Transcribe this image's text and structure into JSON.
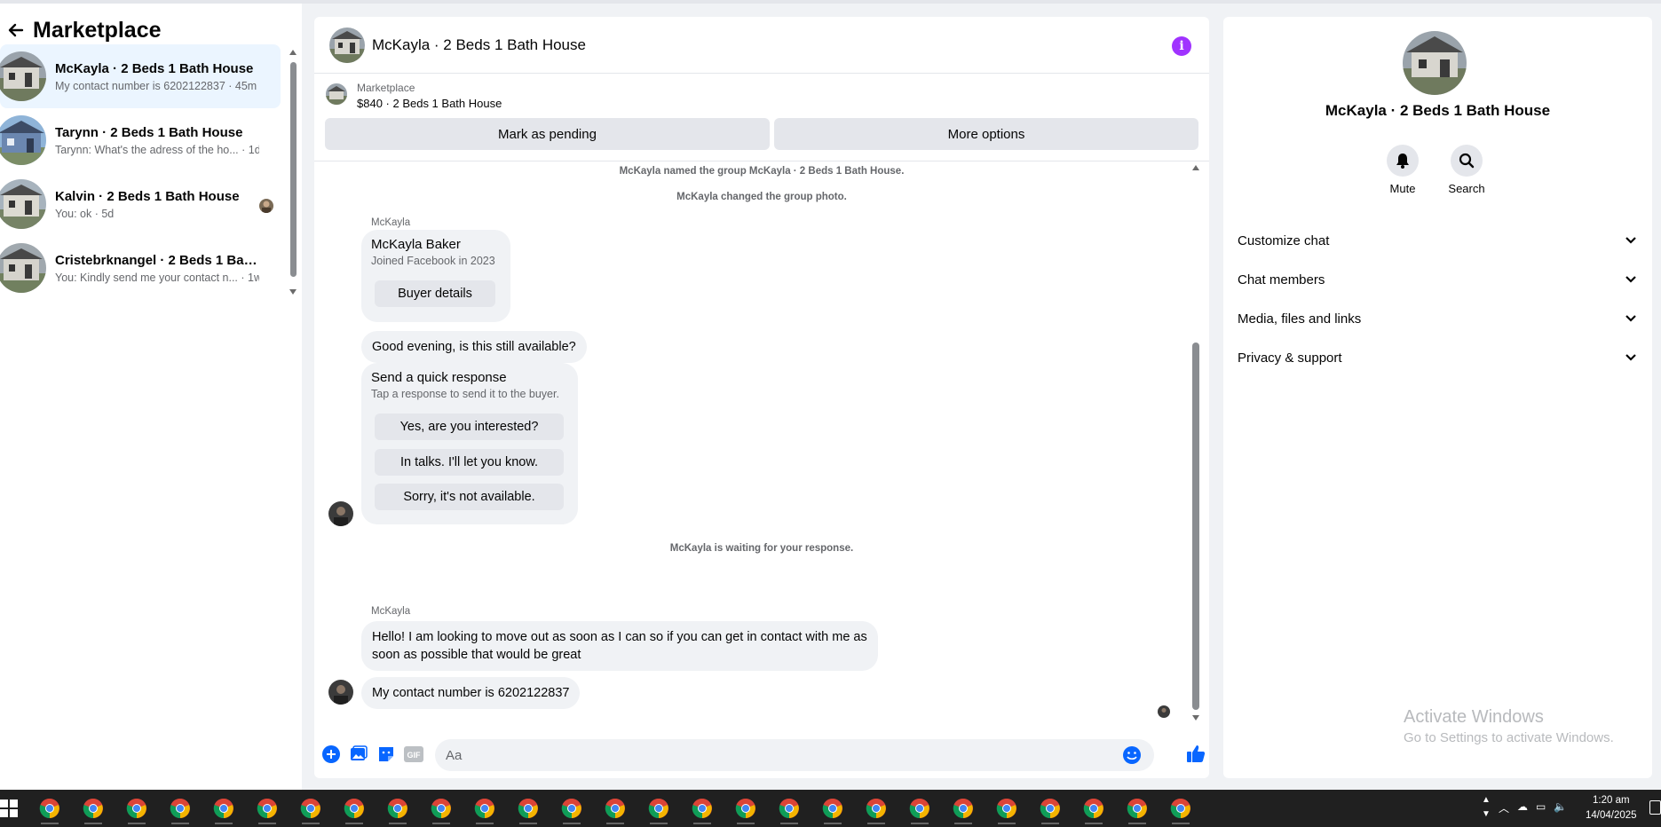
{
  "sidebar": {
    "title": "Marketplace",
    "conversations": [
      {
        "name": "McKayla · 2 Beds 1 Bath House",
        "snippet": "My contact number is 6202122837 · 45m",
        "active": true
      },
      {
        "name": "Tarynn · 2 Beds 1 Bath House",
        "snippet": "Tarynn: What's the adress of the ho... · 1d",
        "active": false
      },
      {
        "name": "Kalvin · 2 Beds 1 Bath House",
        "snippet": "You: ok · 5d",
        "active": false
      },
      {
        "name": "Cristebrknangel · 2 Beds 1 Bath ...",
        "snippet": "You: Kindly send me your contact n... · 1w",
        "active": false
      }
    ]
  },
  "chat": {
    "title": "McKayla · 2 Beds 1 Bath House",
    "listing": {
      "category": "Marketplace",
      "title": "$840 · 2 Beds 1 Bath House"
    },
    "mark_pending_label": "Mark as pending",
    "more_options_label": "More options",
    "system_messages": {
      "named_group": "McKayla named the group McKayla · 2 Beds 1 Bath House.",
      "changed_photo": "McKayla changed the group photo.",
      "waiting": "McKayla is waiting for your response."
    },
    "sender_name": "McKayla",
    "profile_card": {
      "name": "McKayla Baker",
      "joined": "Joined Facebook in 2023",
      "button": "Buyer details"
    },
    "message_1": "Good evening, is this still available?",
    "quick_response": {
      "title": "Send a quick response",
      "subtitle": "Tap a response to send it to the buyer.",
      "options": [
        "Yes, are you interested?",
        "In talks. I'll let you know.",
        "Sorry, it's not available."
      ]
    },
    "message_2": "Hello! I am looking to move out as soon as I can so if you can get in contact with me as soon as possible that would be great",
    "message_3": "My contact number is 6202122837",
    "composer_placeholder": "Aa"
  },
  "right_panel": {
    "title": "McKayla · 2 Beds 1 Bath House",
    "mute_label": "Mute",
    "search_label": "Search",
    "sections": [
      "Customize chat",
      "Chat members",
      "Media, files and links",
      "Privacy & support"
    ],
    "watermark_title": "Activate Windows",
    "watermark_sub": "Go to Settings to activate Windows."
  },
  "taskbar": {
    "time": "1:20 am",
    "date": "14/04/2025"
  },
  "colors": {
    "accent": "#0866ff",
    "info": "#a033ff",
    "active_row": "#ebf5ff"
  }
}
